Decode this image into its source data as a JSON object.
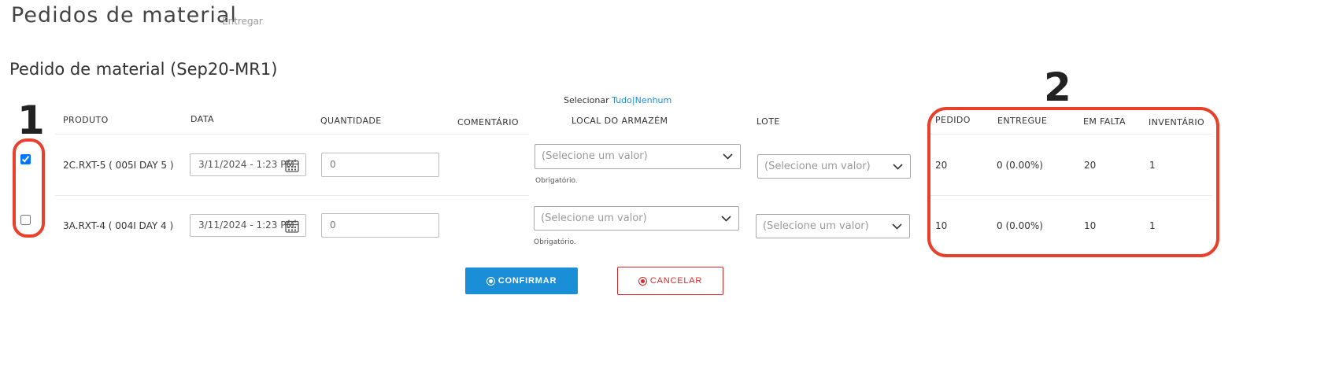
{
  "page": {
    "title": "Pedidos de material",
    "subtitle": "Entregar"
  },
  "order": {
    "title": "Pedido de material (Sep20-MR1)"
  },
  "select": {
    "label": "Selecionar",
    "all": "Tudo",
    "separator": "|",
    "none": "Nenhum"
  },
  "columns": {
    "product": "PRODUTO",
    "date": "DATA",
    "quantity": "QUANTIDADE",
    "comment": "COMENTÁRIO",
    "location": "LOCAL DO ARMAZÉM",
    "lot": "LOTE",
    "ordered": "PEDIDO",
    "delivered": "ENTREGUE",
    "missing": "EM FALTA",
    "inventory": "INVENTÁRIO"
  },
  "rows": [
    {
      "checked": true,
      "product": "2C.RXT-5 ( 005I DAY 5 )",
      "date": "3/11/2024 - 1:23 PM",
      "quantity": "0",
      "comment": "",
      "location_placeholder": "(Selecione um valor)",
      "location_required": "Obrigatório.",
      "lot_placeholder": "(Selecione um valor)",
      "ordered": "20",
      "delivered": "0 (0.00%)",
      "missing": "20",
      "inventory": "1"
    },
    {
      "checked": false,
      "product": "3A.RXT-4 ( 004I DAY 4 )",
      "date": "3/11/2024 - 1:23 PM",
      "quantity": "0",
      "comment": "",
      "location_placeholder": "(Selecione um valor)",
      "location_required": "Obrigatório.",
      "lot_placeholder": "(Selecione um valor)",
      "ordered": "10",
      "delivered": "0 (0.00%)",
      "missing": "10",
      "inventory": "1"
    }
  ],
  "actions": {
    "confirm": "CONFIRMAR",
    "cancel": "CANCELAR"
  },
  "annotations": {
    "marker_1": "1",
    "marker_2": "2",
    "highlight_color": "#e8402a"
  },
  "colors": {
    "primary": "#1a8fd8",
    "danger": "#d42a2a"
  },
  "icons": {
    "date": "calendar-icon",
    "select": "chevron-down-icon",
    "confirm": "plus-circle-icon",
    "cancel": "close-circle-icon"
  }
}
